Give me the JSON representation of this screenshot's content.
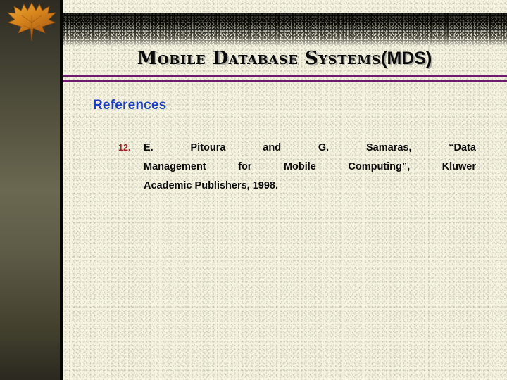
{
  "slide": {
    "title_main": "Mobile Database Systems",
    "title_tail": "(MDS)",
    "heading": "References",
    "accent_color": "#6b1d6b",
    "heading_color": "#1b3fbe",
    "number_color": "#9e2024",
    "body_color": "#0c0c0c",
    "sidebar_color": "#6a6850",
    "paper_color": "#f5f3e0"
  },
  "decor": {
    "leaf_icon": "maple-leaf-icon",
    "leaf_colors": [
      "#d98c1a",
      "#c6731a",
      "#e8a83a",
      "#a85a14"
    ]
  },
  "references": [
    {
      "number": "12.",
      "line1": "E.    Pitoura    and    G.    Samaras,    “Data",
      "line2": "Management  for  Mobile  Computing”,  Kluwer",
      "line3": "Academic Publishers, 1998.",
      "full_text": "E. Pitoura and G. Samaras, “Data Management for Mobile Computing”, Kluwer Academic Publishers, 1998."
    }
  ]
}
